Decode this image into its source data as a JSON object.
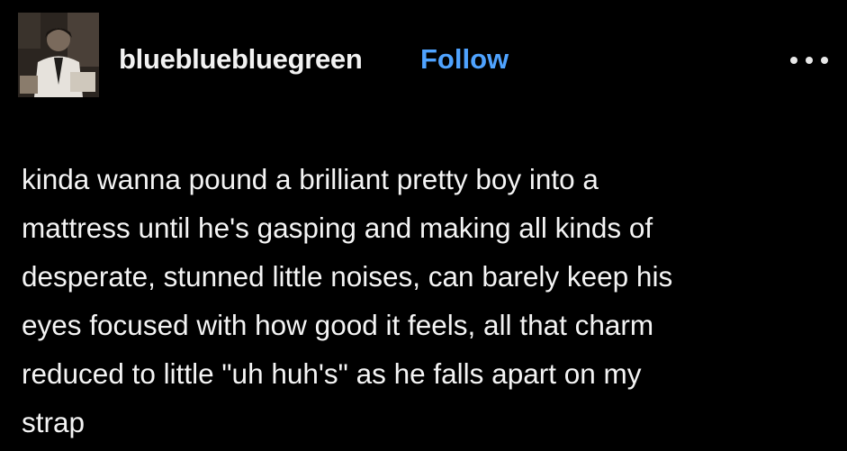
{
  "post": {
    "username": "bluebluebluegreen",
    "follow_label": "Follow",
    "avatar": "avatar-image",
    "more_icon": "more-options-icon",
    "text": "kinda wanna pound a brilliant pretty boy into a\nmattress until he's gasping and making all kinds of\ndesperate, stunned little noises, can barely keep his\neyes focused with how good it feels, all that charm\nreduced to little \"uh huh's\" as he falls apart on my\nstrap"
  },
  "colors": {
    "background": "#000000",
    "text": "#f4f4f4",
    "follow": "#4fa3ff"
  }
}
